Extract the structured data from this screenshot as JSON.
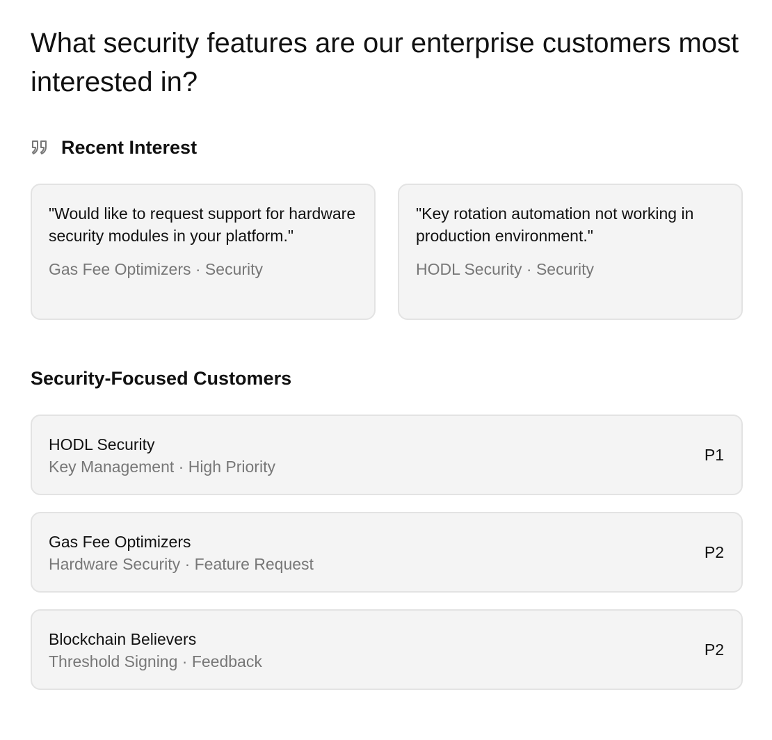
{
  "question": "What security features are our enterprise customers most interested in?",
  "recent_interest": {
    "icon": "quote-icon",
    "title": "Recent Interest",
    "quotes": [
      {
        "text": "\"Would like to request support for hardware security modules in your platform.\"",
        "meta": "Gas Fee Optimizers · Security"
      },
      {
        "text": "\"Key rotation automation not working in production environment.\"",
        "meta": "HODL Security · Security"
      }
    ]
  },
  "customers": {
    "title": "Security-Focused Customers",
    "items": [
      {
        "name": "HODL Security",
        "meta": "Key Management · High Priority",
        "priority": "P1"
      },
      {
        "name": "Gas Fee Optimizers",
        "meta": "Hardware Security · Feature Request",
        "priority": "P2"
      },
      {
        "name": "Blockchain Believers",
        "meta": "Threshold Signing · Feedback",
        "priority": "P2"
      }
    ]
  },
  "colors": {
    "card_background": "#f4f4f4",
    "card_border": "#e3e3e3",
    "muted_text": "#777777",
    "primary_text": "#111111"
  }
}
